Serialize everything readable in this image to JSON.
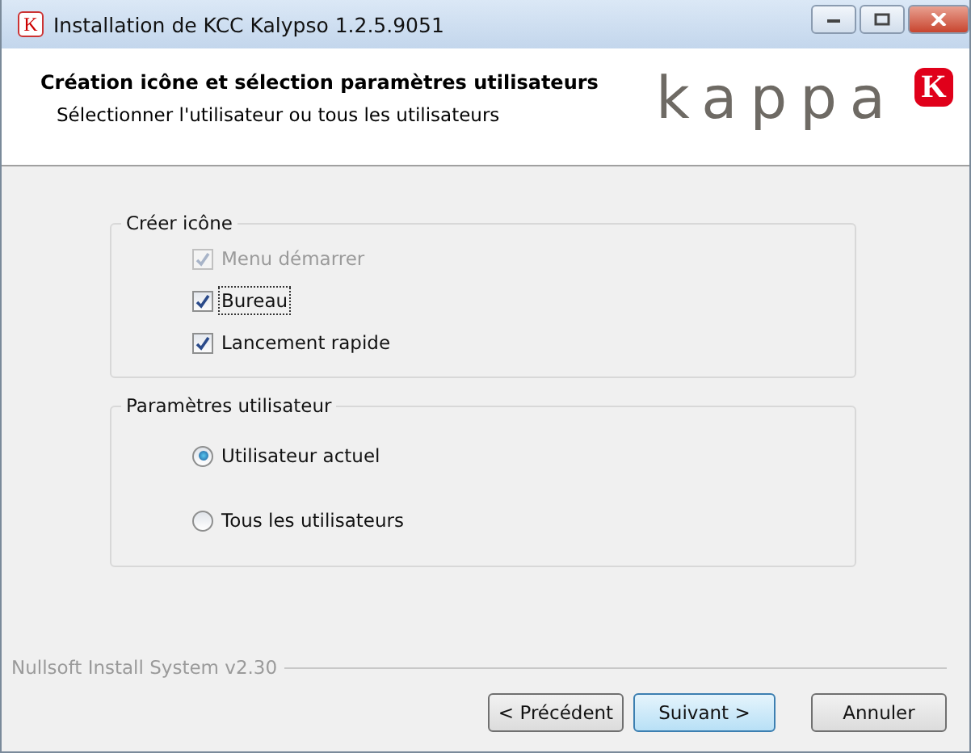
{
  "window": {
    "icon_text": "K",
    "title": "Installation de KCC Kalypso 1.2.5.9051"
  },
  "header": {
    "title": "Création icône et sélection paramètres utilisateurs",
    "subtitle": "Sélectionner l'utilisateur ou tous les utilisateurs",
    "logo_text": "kappa",
    "logo_badge": "K"
  },
  "groups": [
    {
      "title": "Créer icône",
      "items": [
        {
          "kind": "checkbox",
          "label": "Menu démarrer",
          "checked": true,
          "disabled": true,
          "focused": false
        },
        {
          "kind": "checkbox",
          "label": "Bureau",
          "checked": true,
          "disabled": false,
          "focused": true
        },
        {
          "kind": "checkbox",
          "label": "Lancement rapide",
          "checked": true,
          "disabled": false,
          "focused": false
        }
      ]
    },
    {
      "title": "Paramètres utilisateur",
      "items": [
        {
          "kind": "radio",
          "label": "Utilisateur actuel",
          "selected": true,
          "disabled": false,
          "focused": false
        },
        {
          "kind": "radio",
          "label": "Tous les utilisateurs",
          "selected": false,
          "disabled": false,
          "focused": false
        }
      ]
    }
  ],
  "branding": "Nullsoft Install System v2.30",
  "buttons": [
    {
      "label": "< Précédent",
      "default": false
    },
    {
      "label": "Suivant >",
      "default": true
    },
    {
      "label": "Annuler",
      "default": false
    }
  ]
}
